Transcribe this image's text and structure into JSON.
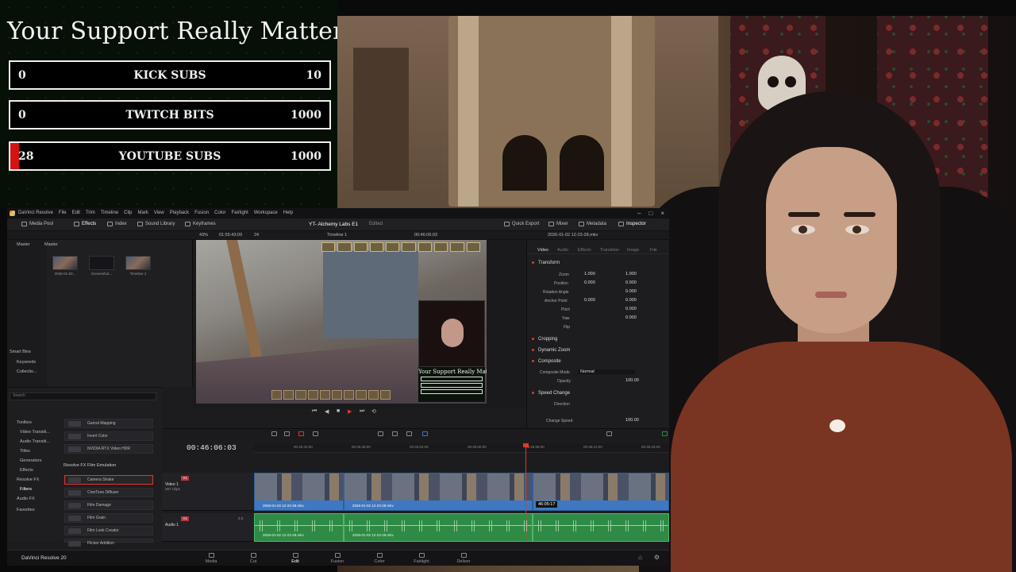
{
  "goals": {
    "title": "Your Support Really Matters",
    "bars": [
      {
        "current": "0",
        "label": "KICK SUBS",
        "target": "10",
        "progress": 0
      },
      {
        "current": "0",
        "label": "TWITCH BITS",
        "target": "1000",
        "progress": 0
      },
      {
        "current": "28",
        "label": "YOUTUBE SUBS",
        "target": "1000",
        "progress": 0.028
      }
    ]
  },
  "resolve": {
    "menu": [
      "DaVinci Resolve",
      "File",
      "Edit",
      "Trim",
      "Timeline",
      "Clip",
      "Mark",
      "View",
      "Playback",
      "Fusion",
      "Color",
      "Fairlight",
      "Workspace",
      "Help"
    ],
    "toolbar": {
      "media_pool": "Media Pool",
      "effects": "Effects",
      "index": "Index",
      "sound_library": "Sound Library",
      "keyframes": "Keyframes",
      "project_title": "YT- Alchemy Labs E1",
      "edited": "Edited",
      "quick_export": "Quick Export",
      "mixer": "Mixer",
      "metadata": "Metadata",
      "inspector": "Inspector"
    },
    "subbar": {
      "zoom": "43%",
      "source_timecode": "01:55:43:09",
      "fps": "24",
      "timeline_name": "Timeline 1",
      "record_timecode": "00:46:06:03",
      "clip_name": "2026-01-02 12-23-28.mkv"
    },
    "media_pool": {
      "master_label": "Master",
      "bin_header": "Master",
      "clips": [
        "2026-01-02...",
        "Screenshot...",
        "Timeline 1"
      ],
      "smart_bins": "Smart Bins",
      "keywords": "Keywords",
      "collections": "Collectio..."
    },
    "effects": {
      "search_placeholder": "Search",
      "tree": [
        "Toolbox",
        "Video Transiti...",
        "Audio Transiti...",
        "Titles",
        "Generators",
        "Effects",
        "Resolve FX",
        "Filters",
        "Audio FX",
        "Favorites"
      ],
      "fx_items_top": [
        "Gamut Mapping",
        "Invert Color",
        "NVIDIA RTX Video HDR"
      ],
      "group_header": "Resolve FX Film Emulation",
      "fx_items": [
        "Camera Shake",
        "CineTone Diffuser",
        "Film Damage",
        "Film Grain",
        "Film Look Creator",
        "Flicker Addition"
      ]
    },
    "viewer": {
      "overlay_title": "Your Support Really Matters"
    },
    "inspector": {
      "tabs": [
        "Video",
        "Audio",
        "Effects",
        "Transition",
        "Image",
        "File"
      ],
      "transform": "Transform",
      "params": [
        {
          "name": "Zoom",
          "x": "1.000",
          "y": "1.000"
        },
        {
          "name": "Position",
          "x": "0.000",
          "y": "0.000"
        },
        {
          "name": "Rotation Angle",
          "v": "0.000"
        },
        {
          "name": "Anchor Point",
          "x": "0.000",
          "y": "0.000"
        },
        {
          "name": "Pitch",
          "v": "0.000"
        },
        {
          "name": "Yaw",
          "v": "0.000"
        },
        {
          "name": "Flip",
          "v": ""
        }
      ],
      "cropping": "Cropping",
      "dynamic_zoom": "Dynamic Zoom",
      "composite": "Composite",
      "composite_mode_label": "Composite Mode",
      "composite_mode": "Normal",
      "opacity_label": "Opacity",
      "opacity": "100.00",
      "speed_change": "Speed Change",
      "direction_label": "Direction",
      "change_speed_label": "Change Speed",
      "change_speed": "100.00"
    },
    "timeline": {
      "timecode": "00:46:06:03",
      "ruler": [
        "00:45:42:00",
        "00:45:48:00",
        "00:45:54:00",
        "00:46:00:00",
        "00:46:06:00",
        "00:46:12:00",
        "00:46:18:00"
      ],
      "video_track": {
        "tag": "V1",
        "name": "Video 1",
        "sub": "267 Clips"
      },
      "audio_track": {
        "tag": "A1",
        "name": "Audio 1",
        "level": "2.0"
      },
      "clip_name": "2026-01-02 12-23-28.mkv",
      "hover_timecode": "46:05:17"
    },
    "pages": [
      "Media",
      "Cut",
      "Edit",
      "Fusion",
      "Color",
      "Fairlight",
      "Deliver"
    ],
    "active_page": "Edit",
    "brand": "DaVinci Resolve 20"
  },
  "colors": {
    "accent_red": "#e3372a",
    "video_clip_blue": "#3e78c2",
    "audio_clip_green": "#2f8a45",
    "goal_fill_red": "#d51212"
  }
}
